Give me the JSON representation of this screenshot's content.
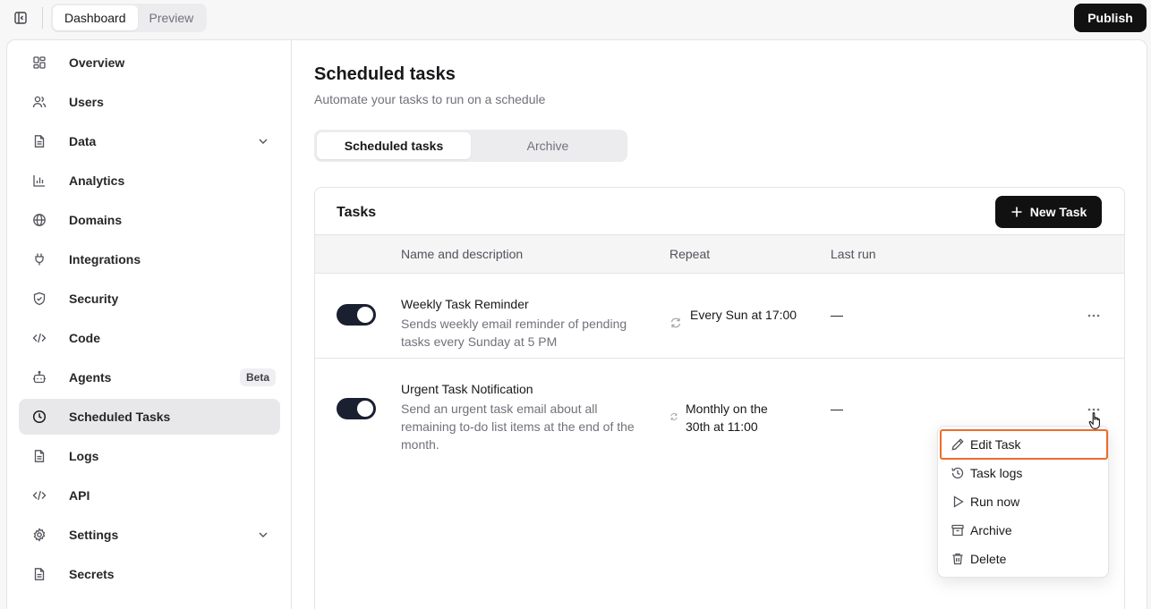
{
  "topbar": {
    "view_tabs": [
      "Dashboard",
      "Preview"
    ],
    "publish_label": "Publish"
  },
  "sidebar": {
    "items": [
      {
        "label": "Overview",
        "icon": "layout-grid-icon"
      },
      {
        "label": "Users",
        "icon": "users-icon"
      },
      {
        "label": "Data",
        "icon": "file-icon",
        "expandable": true
      },
      {
        "label": "Analytics",
        "icon": "bar-chart-icon"
      },
      {
        "label": "Domains",
        "icon": "globe-icon"
      },
      {
        "label": "Integrations",
        "icon": "plug-icon"
      },
      {
        "label": "Security",
        "icon": "shield-check-icon"
      },
      {
        "label": "Code",
        "icon": "code-icon"
      },
      {
        "label": "Agents",
        "icon": "bot-icon",
        "badge": "Beta"
      },
      {
        "label": "Scheduled Tasks",
        "icon": "clock-icon",
        "active": true
      },
      {
        "label": "Logs",
        "icon": "file-text-icon"
      },
      {
        "label": "API",
        "icon": "code-icon"
      },
      {
        "label": "Settings",
        "icon": "gear-icon",
        "expandable": true
      },
      {
        "label": "Secrets",
        "icon": "file-lock-icon"
      }
    ]
  },
  "main": {
    "title": "Scheduled tasks",
    "subtitle": "Automate your tasks to run on a schedule",
    "tabs": [
      "Scheduled tasks",
      "Archive"
    ],
    "active_tab": "Scheduled tasks"
  },
  "tasks_card": {
    "title": "Tasks",
    "new_task_label": "New Task",
    "columns": [
      "Name and description",
      "Repeat",
      "Last run"
    ],
    "rows": [
      {
        "enabled": true,
        "name": "Weekly Task Reminder",
        "description": "Sends weekly email reminder of pending tasks every Sunday at 5 PM",
        "repeat": "Every Sun at 17:00",
        "last_run": "—"
      },
      {
        "enabled": true,
        "name": "Urgent Task Notification",
        "description": "Send an urgent task email about all remaining to-do list items at the end of the month.",
        "repeat": "Monthly on the 30th at 11:00",
        "last_run": "—"
      }
    ]
  },
  "context_menu": {
    "items": [
      {
        "label": "Edit Task",
        "icon": "pencil-icon",
        "focused": true
      },
      {
        "label": "Task logs",
        "icon": "history-icon"
      },
      {
        "label": "Run now",
        "icon": "play-icon"
      },
      {
        "label": "Archive",
        "icon": "archive-icon"
      },
      {
        "label": "Delete",
        "icon": "trash-icon"
      }
    ]
  },
  "colors": {
    "accent_dark": "#111111",
    "focus_outline": "#f06a2a",
    "muted_text": "#71717a",
    "active_nav_bg": "#e8e8ea"
  }
}
